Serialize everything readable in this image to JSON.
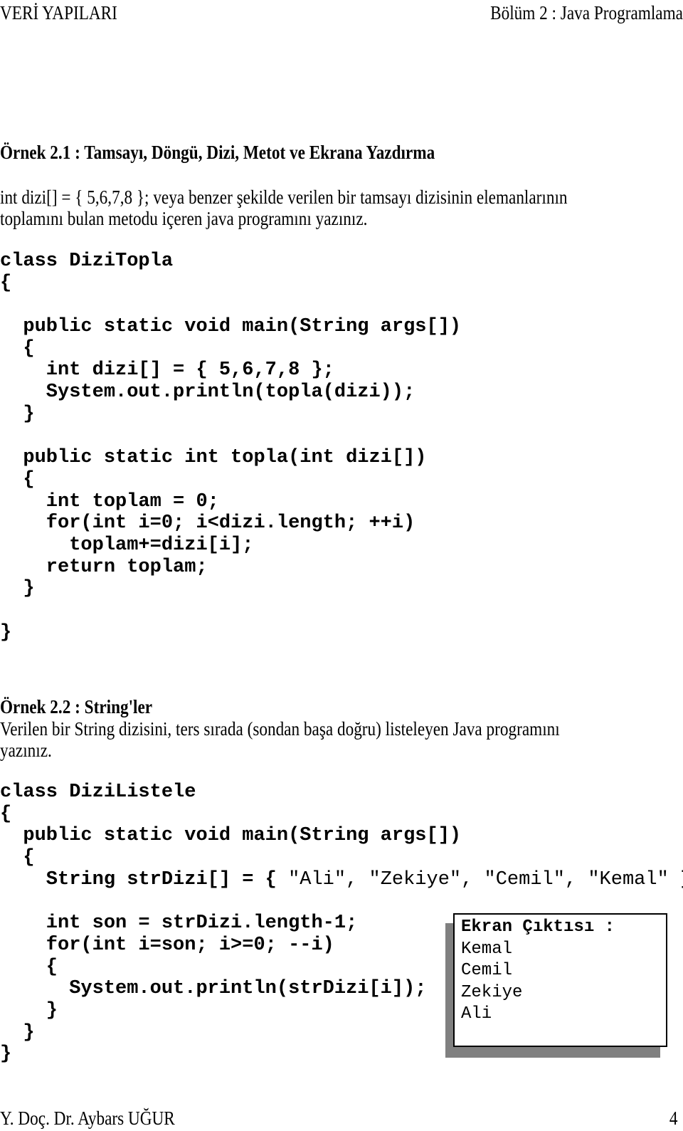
{
  "header": {
    "left": "VERİ YAPILARI",
    "right": "Bölüm 2 : Java Programlama"
  },
  "example1": {
    "title": "Örnek 2.1 : Tamsayı, Döngü, Dizi, Metot ve Ekrana Yazdırma",
    "description": [
      "int dizi[] = { 5,6,7,8 }; veya benzer şekilde verilen bir tamsayı dizisinin elemanlarının",
      "toplamını bulan metodu içeren java programını yazınız."
    ],
    "code": [
      "class DiziTopla",
      "{",
      "",
      "  public static void main(String args[])",
      "  {",
      "    int dizi[] = { 5,6,7,8 };",
      "    System.out.println(topla(dizi));",
      "  }",
      "",
      "  public static int topla(int dizi[])",
      "  {",
      "    int toplam = 0;",
      "    for(int i=0; i<dizi.length; ++i)",
      "      toplam+=dizi[i];",
      "    return toplam;",
      "  }",
      "",
      "}"
    ]
  },
  "example2": {
    "title": "Örnek 2.2 : String'ler",
    "description": [
      "Verilen bir String dizisini, ters sırada (sondan başa doğru) listeleyen Java programını",
      "yazınız."
    ],
    "code_head": [
      "class DiziListele",
      "{",
      "  public static void main(String args[])",
      "  {"
    ],
    "code_array_line": {
      "prefix": "    String strDizi[] = { ",
      "literals": "\"Ali\", \"Zekiye\", \"Cemil\", \"Kemal\"",
      "suffix": " };"
    },
    "code_tail": [
      "",
      "    int son = strDizi.length-1;",
      "    for(int i=son; i>=0; --i)",
      "    {",
      "      System.out.println(strDizi[i]);",
      "    }",
      "  }",
      "}"
    ],
    "output_box": {
      "title": "Ekran Çıktısı :",
      "lines": [
        "Kemal",
        "Cemil",
        "Zekiye",
        "Ali"
      ]
    }
  },
  "footer": {
    "author": "Y. Doç. Dr. Aybars UĞUR",
    "page_number": "4"
  }
}
